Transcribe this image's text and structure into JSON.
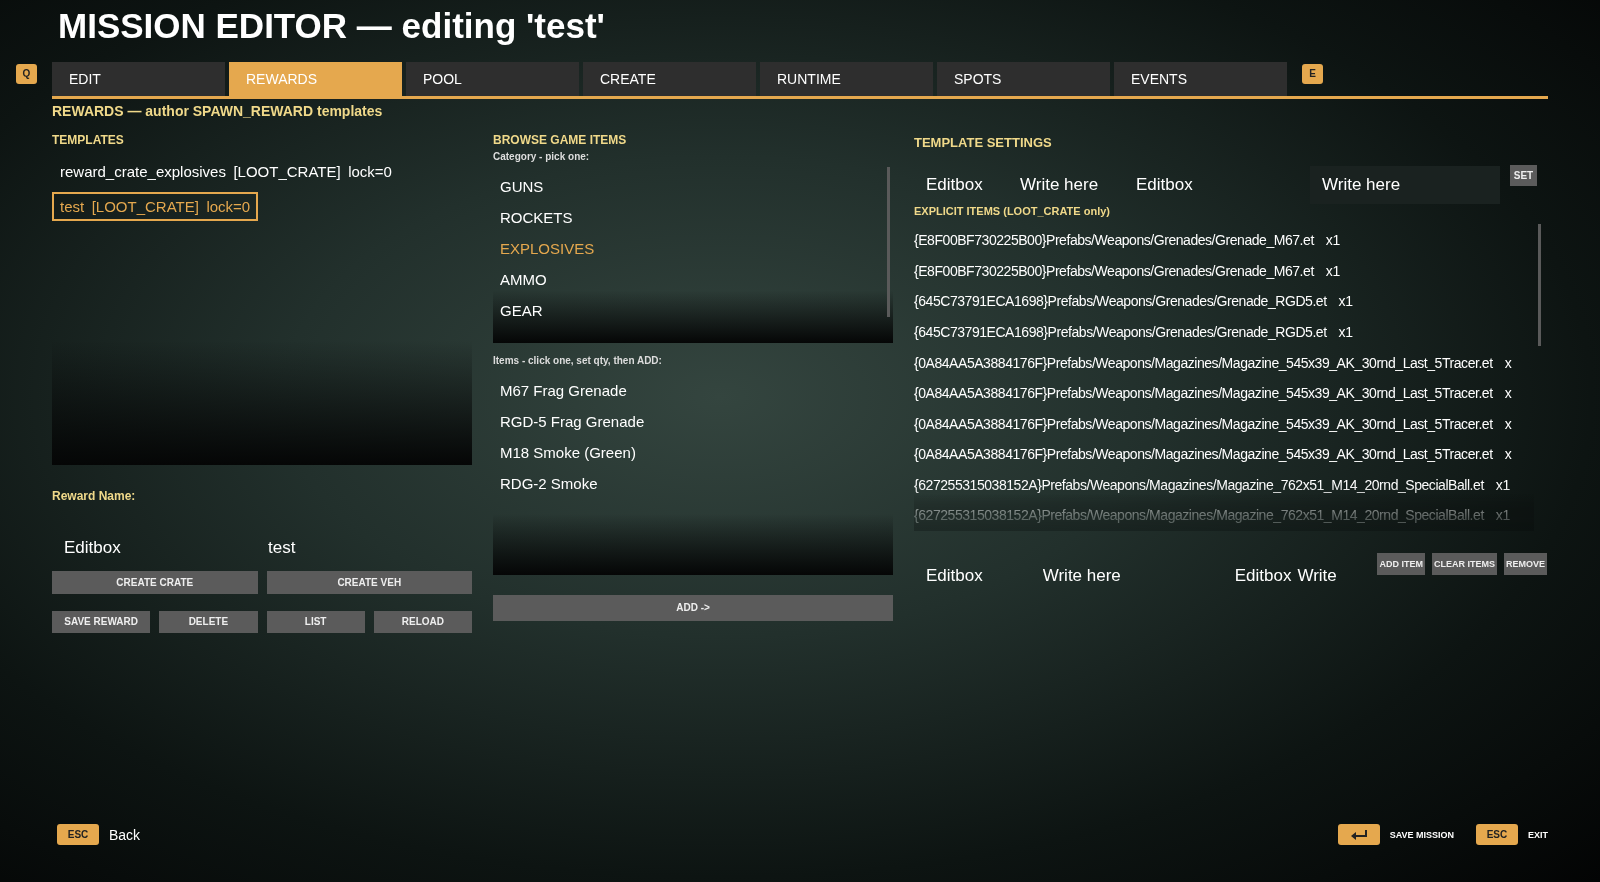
{
  "title": "MISSION EDITOR — editing 'test'",
  "tab_keys": {
    "prev": "Q",
    "next": "E"
  },
  "tabs": [
    {
      "label": "EDIT",
      "selected": false
    },
    {
      "label": "REWARDS",
      "selected": true
    },
    {
      "label": "POOL",
      "selected": false
    },
    {
      "label": "CREATE",
      "selected": false
    },
    {
      "label": "RUNTIME",
      "selected": false
    },
    {
      "label": "SPOTS",
      "selected": false
    },
    {
      "label": "EVENTS",
      "selected": false
    }
  ],
  "page_heading": "REWARDS — author SPAWN_REWARD templates",
  "templates": {
    "heading": "TEMPLATES",
    "items": [
      {
        "name": "reward_crate_explosives",
        "type": "[LOOT_CRATE]",
        "lock": "lock=0",
        "selected": false
      },
      {
        "name": "test",
        "type": "[LOOT_CRATE]",
        "lock": "lock=0",
        "selected": true
      }
    ],
    "name_label": "Reward Name:",
    "name_field_label": "Editbox",
    "name_value": "test",
    "wide_buttons": [
      "CREATE CRATE",
      "CREATE VEH"
    ],
    "buttons": [
      "SAVE REWARD",
      "DELETE",
      "LIST",
      "RELOAD"
    ]
  },
  "browse": {
    "heading": "BROWSE GAME ITEMS",
    "category_label": "Category - pick one:",
    "categories": [
      {
        "label": "GUNS",
        "selected": false
      },
      {
        "label": "ROCKETS",
        "selected": false
      },
      {
        "label": "EXPLOSIVES",
        "selected": true
      },
      {
        "label": "AMMO",
        "selected": false
      },
      {
        "label": "GEAR",
        "selected": false
      }
    ],
    "items_label": "Items - click one, set qty, then ADD:",
    "items": [
      "M67 Frag Grenade",
      "RGD-5 Frag Grenade",
      "M18 Smoke (Green)",
      "RDG-2 Smoke"
    ],
    "add_button": "ADD ->"
  },
  "settings": {
    "heading": "TEMPLATE SETTINGS",
    "fields": [
      {
        "label": "Editbox",
        "placeholder": "Write here"
      },
      {
        "label": "Editbox",
        "placeholder": "Write here"
      }
    ],
    "set_button": "SET",
    "explicit_heading": "EXPLICIT ITEMS (LOOT_CRATE only)",
    "explicit_items": [
      {
        "path": "{E8F00BF730225B00}Prefabs/Weapons/Grenades/Grenade_M67.et",
        "qty": "x1"
      },
      {
        "path": "{E8F00BF730225B00}Prefabs/Weapons/Grenades/Grenade_M67.et",
        "qty": "x1"
      },
      {
        "path": "{645C73791ECA1698}Prefabs/Weapons/Grenades/Grenade_RGD5.et",
        "qty": "x1"
      },
      {
        "path": "{645C73791ECA1698}Prefabs/Weapons/Grenades/Grenade_RGD5.et",
        "qty": "x1"
      },
      {
        "path": "{0A84AA5A3884176F}Prefabs/Weapons/Magazines/Magazine_545x39_AK_30rnd_Last_5Tracer.et",
        "qty": "x"
      },
      {
        "path": "{0A84AA5A3884176F}Prefabs/Weapons/Magazines/Magazine_545x39_AK_30rnd_Last_5Tracer.et",
        "qty": "x"
      },
      {
        "path": "{0A84AA5A3884176F}Prefabs/Weapons/Magazines/Magazine_545x39_AK_30rnd_Last_5Tracer.et",
        "qty": "x"
      },
      {
        "path": "{0A84AA5A3884176F}Prefabs/Weapons/Magazines/Magazine_545x39_AK_30rnd_Last_5Tracer.et",
        "qty": "x"
      },
      {
        "path": "{627255315038152A}Prefabs/Weapons/Magazines/Magazine_762x51_M14_20rnd_SpecialBall.et",
        "qty": "x1"
      },
      {
        "path": "{627255315038152A}Prefabs/Weapons/Magazines/Magazine_762x51_M14_20rnd_SpecialBall.et",
        "qty": "x1"
      }
    ],
    "bottom_fields": [
      {
        "label": "Editbox",
        "placeholder": "Write here"
      },
      {
        "label": "Editbox",
        "placeholder": "Write"
      }
    ],
    "item_buttons": [
      "ADD ITEM",
      "CLEAR ITEMS",
      "REMOVE"
    ]
  },
  "footer": {
    "left": [
      {
        "kind": "text",
        "key": "ESC",
        "label": "Back"
      }
    ],
    "right": [
      {
        "kind": "enter",
        "label": "SAVE MISSION"
      },
      {
        "kind": "text",
        "key": "ESC",
        "label": "EXIT"
      }
    ]
  }
}
